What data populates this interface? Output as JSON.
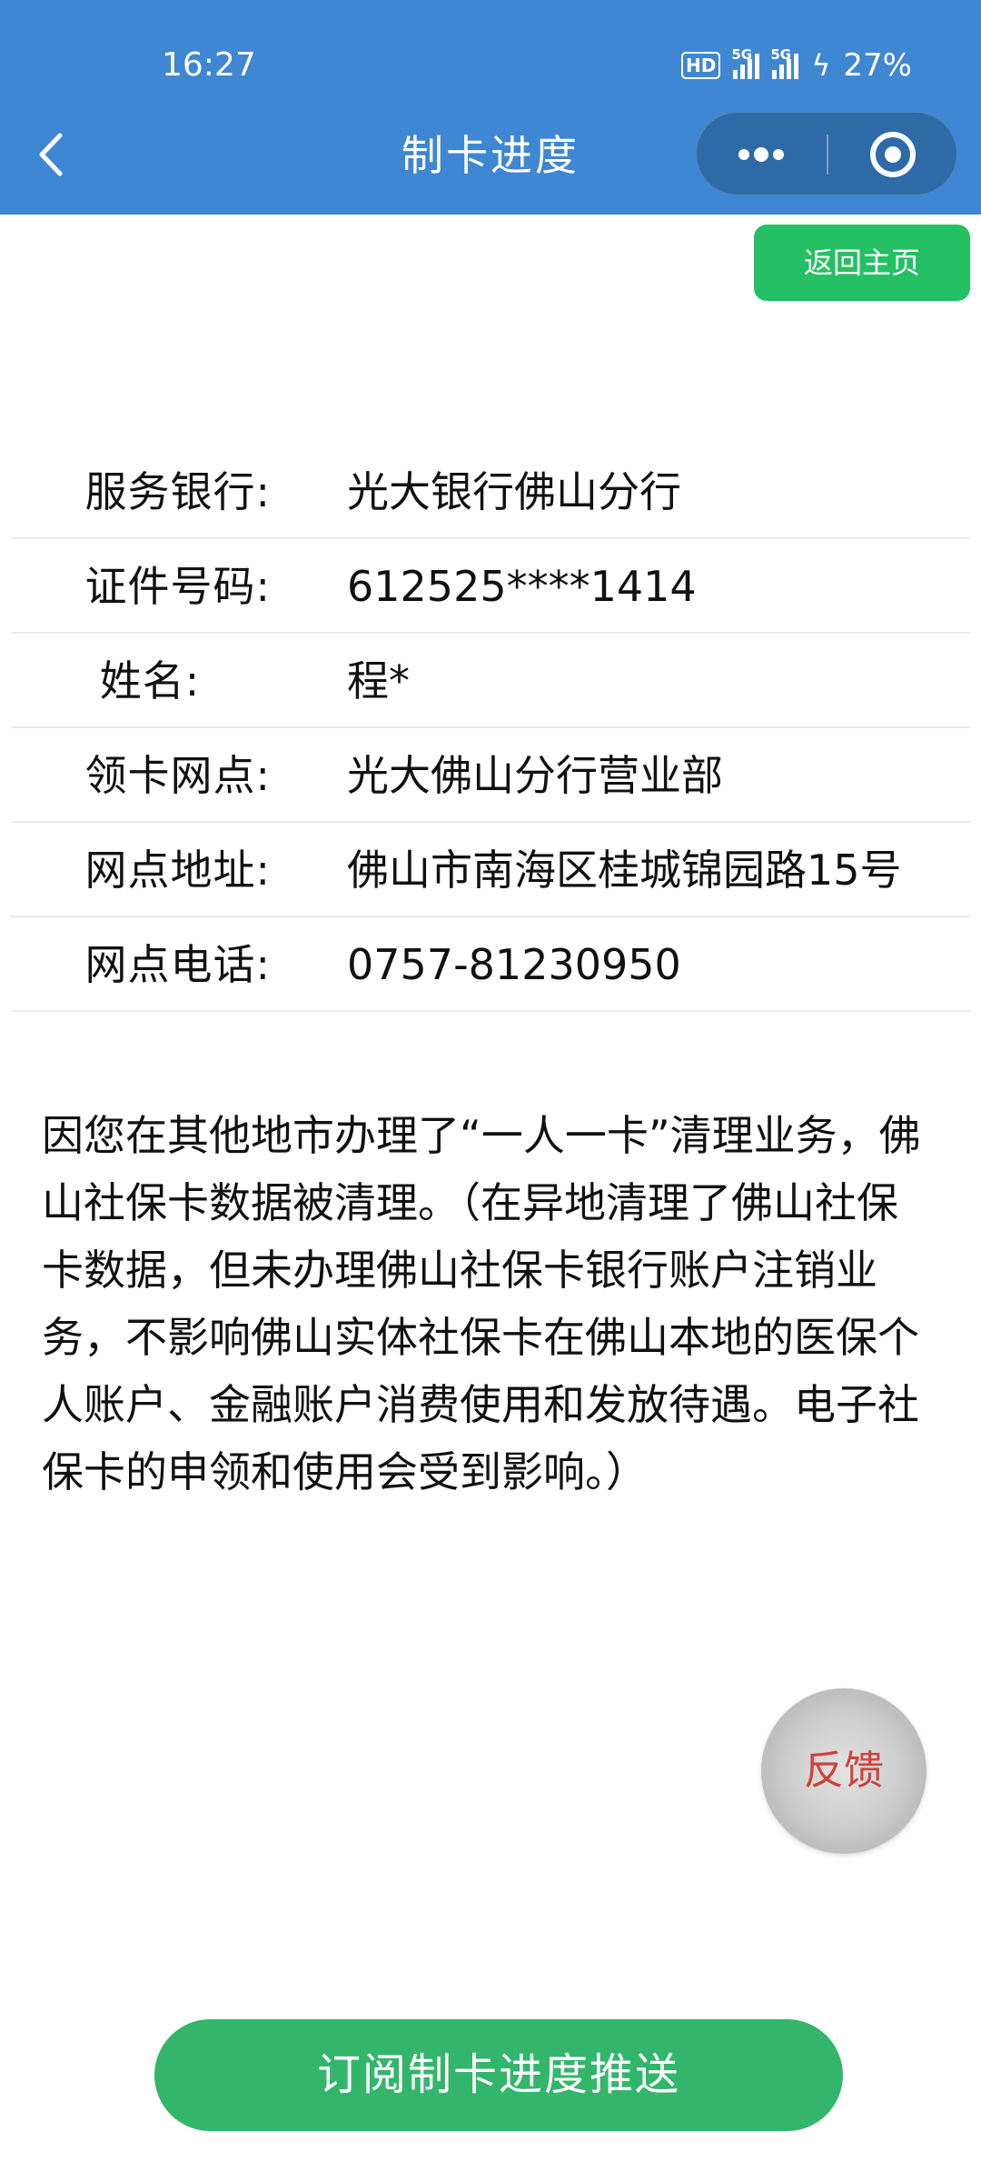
{
  "status_bar": {
    "time": "16:27",
    "hd_label": "HD",
    "net1": "5G",
    "net2": "5G",
    "battery": "27%"
  },
  "nav": {
    "title": "制卡进度",
    "back_icon": "chevron-left-icon",
    "more_icon": "more-dots-icon",
    "close_icon": "target-circle-icon"
  },
  "home_button": "返回主页",
  "info": {
    "rows": [
      {
        "label": "服务银行:",
        "value": "光大银行佛山分行"
      },
      {
        "label": "证件号码:",
        "value": "612525****1414"
      },
      {
        "label": "姓名:",
        "value": "程*"
      },
      {
        "label": "领卡网点:",
        "value": "光大佛山分行营业部"
      },
      {
        "label": "网点地址:",
        "value": "佛山市南海区桂城锦园路15号"
      },
      {
        "label": "网点电话:",
        "value": "0757-81230950"
      }
    ]
  },
  "notice": "因您在其他地市办理了“一人一卡”清理业务，佛山社保卡数据被清理。（在异地清理了佛山社保卡数据，但未办理佛山社保卡银行账户注销业务，不影响佛山实体社保卡在佛山本地的医保个人账户、金融账户消费使用和发放待遇。电子社保卡的申领和使用会受到影响。）",
  "feedback": "反馈",
  "subscribe_button": "订阅制卡进度推送",
  "colors": {
    "header": "#3f87d2",
    "home_button": "#25c063",
    "subscribe_button": "#33b66b",
    "feedback_text": "#d0413c"
  }
}
